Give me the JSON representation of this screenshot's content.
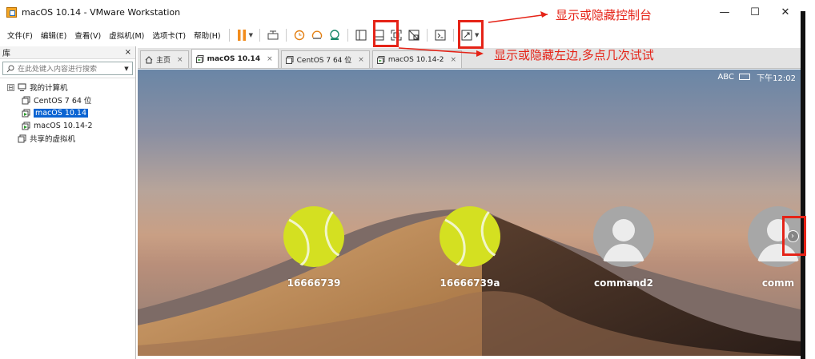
{
  "window": {
    "title": "macOS 10.14 - VMware Workstation",
    "controls": {
      "minimize": "—",
      "maximize": "☐",
      "close": "✕"
    }
  },
  "menu": [
    "文件(F)",
    "编辑(E)",
    "查看(V)",
    "虚拟机(M)",
    "选项卡(T)",
    "帮助(H)"
  ],
  "library": {
    "title": "库",
    "close": "×",
    "search_placeholder": "在此处键入内容进行搜索",
    "tree": {
      "root": "我的计算机",
      "expander": "⊟",
      "items": [
        "CentOS 7 64 位",
        "macOS 10.14",
        "macOS 10.14-2"
      ],
      "shared": "共享的虚拟机"
    }
  },
  "tabs": [
    {
      "label": "主页",
      "close": "×"
    },
    {
      "label": "macOS 10.14",
      "close": "×"
    },
    {
      "label": "CentOS 7 64 位",
      "close": "×"
    },
    {
      "label": "macOS 10.14-2",
      "close": "×"
    }
  ],
  "vm_screen": {
    "input_source": "ABC",
    "time": "下午12:02",
    "users": [
      "16666739",
      "16666739a",
      "command2",
      "comm"
    ]
  },
  "annotations": {
    "console_toggle": "显示或隐藏控制台",
    "sidebar_toggle": "显示或隐藏左边,多点几次试试"
  },
  "colors": {
    "annotation": "#e52317",
    "selection": "#0a64d2",
    "tennis_ball": "#d4e021"
  }
}
